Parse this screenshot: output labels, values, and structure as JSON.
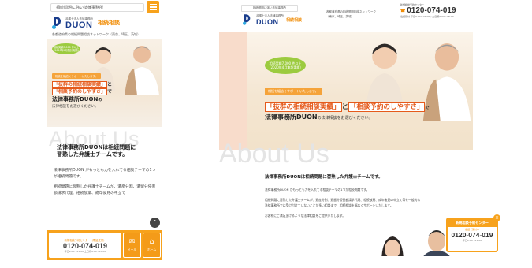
{
  "mobile": {
    "tagline": "相続問題に強い法律事務所",
    "logo_sub": "弁護士法人法律事務所",
    "logo_main": "DUON",
    "logo_badge": "相続相談",
    "desc": "各都道府県の相続問題相談ネットワーク（東京、埼玉、茨城）",
    "bubble_l1": "相続実績7,000 件以上",
    "bubble_l2": "（2020年4月集計実績）",
    "ribbon": "相続を幅広くサポートいたします。",
    "catch_box1": "「抜群の相続相談実績」",
    "catch_and": "と",
    "catch_box2": "「相談予約のしやすさ」",
    "catch_de": "で",
    "catch_firm": "法律事務所DUON",
    "catch_no": "の",
    "catch_tail": "法律相談をお選びください。",
    "about_bg": "About Us",
    "about_head_l1": "法律事務所DUONは相続問題に",
    "about_head_l2": "習熟した弁護士チームです。",
    "body_p1": "法律事務所DUON がもっとも力を入れてる相談テーマの1つが相続問題です。",
    "body_p2": "相続問題に習熟した弁護士チームが、遺産分割、遺留分侵害額請求代理、相続放棄、成年後見の申立て",
    "scroll_top": "⌃",
    "footer_cap": "新規相談予約センター（電話受付）",
    "footer_num": "0120-074-019",
    "footer_hrs": "平日9:00〜21:00 土日祝9:00〜18:00",
    "footer_mail": "メール",
    "footer_home": "ホーム"
  },
  "desktop": {
    "tagline": "相続問題に強い法律事務所",
    "logo_sub": "弁護士法人法律事務所",
    "logo_main": "DUON",
    "logo_badge": "相続相談",
    "network_l1": "各都道府県の相続問題相談ネットワーク",
    "network_l2": "（東京、埼玉、茨城）",
    "contact_cap": "新規相談予約センター",
    "contact_num": "0120-074-019",
    "contact_hrs": "電話受付 平日9:00〜21:00 / 土日祝9:00〜18:00",
    "bubble_l1": "相続実績7,000 件以上",
    "bubble_l2": "（2020年4月集計実績）",
    "ribbon": "相続を幅広くサポートいたします。",
    "catch_box1": "「抜群の相続相談実績」",
    "catch_and": "と",
    "catch_box2": "「相談予約のしやすさ」",
    "catch_de": "で",
    "catch_firm": "法律事務所DUON",
    "catch_tail": "の法律相談をお選びください。",
    "about_bg": "About Us",
    "about_head": "法律事務所DUONは相続問題に習熟した弁護士チームです。",
    "body_p1": "法律事務所DUON がもっとも力を入れてる相談テーマの1つが相続問題です。",
    "body_p2": "相続問題に習熟した弁護士チームが、遺産分割、遺留分侵害額請求代理、相続放棄、成年後見の申立て等を一般的な法律事務所では受け付けていないことが多い相談まで、相続相談を幅広くサポートいたします。",
    "body_p3": "お客様にご満足頂けるような法律相談をご提供いたします。",
    "float_top": "新規相談予約センター",
    "float_cap": "電話で受付中",
    "float_num": "0120-074-019",
    "float_hrs": "平日9:00〜21:00",
    "float_close": "×"
  },
  "colors": {
    "accent": "#f7a21c",
    "brand": "#1a3d8c",
    "highlight": "#e55a1b",
    "bubble": "#9ccb3f"
  }
}
